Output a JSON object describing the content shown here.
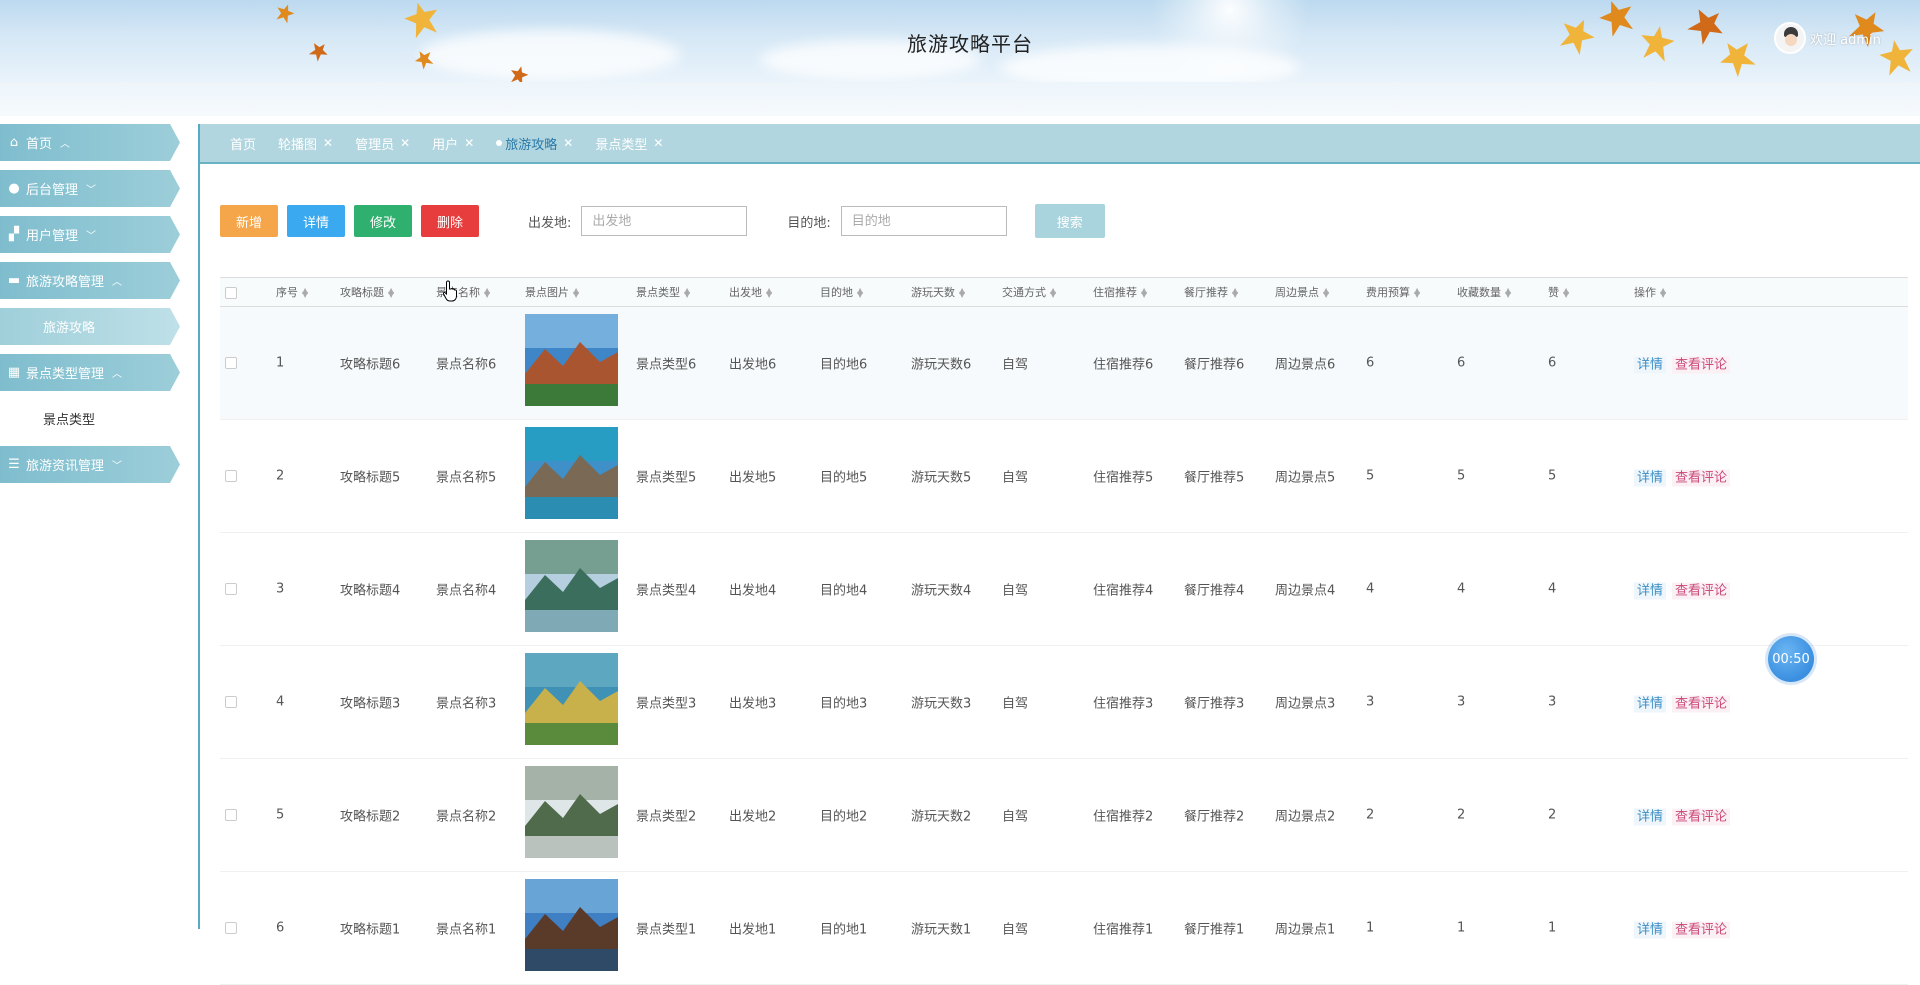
{
  "header": {
    "title": "旅游攻略平台",
    "welcome": "欢迎 admin"
  },
  "sidebar": {
    "items": [
      {
        "label": "首页",
        "icon": "home-icon",
        "chevron": "^"
      },
      {
        "label": "后台管理",
        "icon": "message-icon",
        "chevron": "v"
      },
      {
        "label": "用户管理",
        "icon": "user-edit-icon",
        "chevron": "v"
      },
      {
        "label": "旅游攻略管理",
        "icon": "card-icon",
        "chevron": "^"
      },
      {
        "label": "旅游攻略",
        "sub": true,
        "active": true
      },
      {
        "label": "景点类型管理",
        "icon": "grid-icon",
        "chevron": "^"
      },
      {
        "label": "景点类型",
        "sub": true,
        "active": false
      },
      {
        "label": "旅游资讯管理",
        "icon": "list-icon",
        "chevron": "v"
      }
    ]
  },
  "tabs": [
    {
      "label": "首页",
      "closable": false
    },
    {
      "label": "轮播图",
      "closable": true
    },
    {
      "label": "管理员",
      "closable": true
    },
    {
      "label": "用户",
      "closable": true
    },
    {
      "label": "旅游攻略",
      "closable": true,
      "active": true
    },
    {
      "label": "景点类型",
      "closable": true
    }
  ],
  "toolbar": {
    "add": "新增",
    "detail": "详情",
    "edit": "修改",
    "delete": "删除",
    "origin_label": "出发地:",
    "origin_placeholder": "出发地",
    "dest_label": "目的地:",
    "dest_placeholder": "目的地",
    "search": "搜索"
  },
  "table": {
    "columns": [
      "序号",
      "攻略标题",
      "景点名称",
      "景点图片",
      "景点类型",
      "出发地",
      "目的地",
      "游玩天数",
      "交通方式",
      "住宿推荐",
      "餐厅推荐",
      "周边景点",
      "费用预算",
      "收藏数量",
      "赞",
      "操作"
    ],
    "rows": [
      {
        "no": "1",
        "title": "攻略标题6",
        "name": "景点名称6",
        "type": "景点类型6",
        "from": "出发地6",
        "to": "目的地6",
        "days": "游玩天数6",
        "traffic": "自驾",
        "hotel": "住宿推荐6",
        "food": "餐厅推荐6",
        "nearby": "周边景点6",
        "budget": "6",
        "fav": "6",
        "like": "6",
        "img": "pagoda"
      },
      {
        "no": "2",
        "title": "攻略标题5",
        "name": "景点名称5",
        "type": "景点类型5",
        "from": "出发地5",
        "to": "目的地5",
        "days": "游玩天数5",
        "traffic": "自驾",
        "hotel": "住宿推荐5",
        "food": "餐厅推荐5",
        "nearby": "周边景点5",
        "budget": "5",
        "fav": "5",
        "like": "5",
        "img": "sea-cliff"
      },
      {
        "no": "3",
        "title": "攻略标题4",
        "name": "景点名称4",
        "type": "景点类型4",
        "from": "出发地4",
        "to": "目的地4",
        "days": "游玩天数4",
        "traffic": "自驾",
        "hotel": "住宿推荐4",
        "food": "餐厅推荐4",
        "nearby": "周边景点4",
        "budget": "4",
        "fav": "4",
        "like": "4",
        "img": "karst-river"
      },
      {
        "no": "4",
        "title": "攻略标题3",
        "name": "景点名称3",
        "type": "景点类型3",
        "from": "出发地3",
        "to": "目的地3",
        "days": "游玩天数3",
        "traffic": "自驾",
        "hotel": "住宿推荐3",
        "food": "餐厅推荐3",
        "nearby": "周边景点3",
        "budget": "3",
        "fav": "3",
        "like": "3",
        "img": "islands"
      },
      {
        "no": "5",
        "title": "攻略标题2",
        "name": "景点名称2",
        "type": "景点类型2",
        "from": "出发地2",
        "to": "目的地2",
        "days": "游玩天数2",
        "traffic": "自驾",
        "hotel": "住宿推荐2",
        "food": "餐厅推荐2",
        "nearby": "周边景点2",
        "budget": "2",
        "fav": "2",
        "like": "2",
        "img": "stone-pillars"
      },
      {
        "no": "6",
        "title": "攻略标题1",
        "name": "景点名称1",
        "type": "景点类型1",
        "from": "出发地1",
        "to": "目的地1",
        "days": "游玩天数1",
        "traffic": "自驾",
        "hotel": "住宿推荐1",
        "food": "餐厅推荐1",
        "nearby": "周边景点1",
        "budget": "1",
        "fav": "1",
        "like": "1",
        "img": "temple"
      }
    ],
    "op_detail": "详情",
    "op_comment": "查看评论"
  },
  "timer": "00:50"
}
